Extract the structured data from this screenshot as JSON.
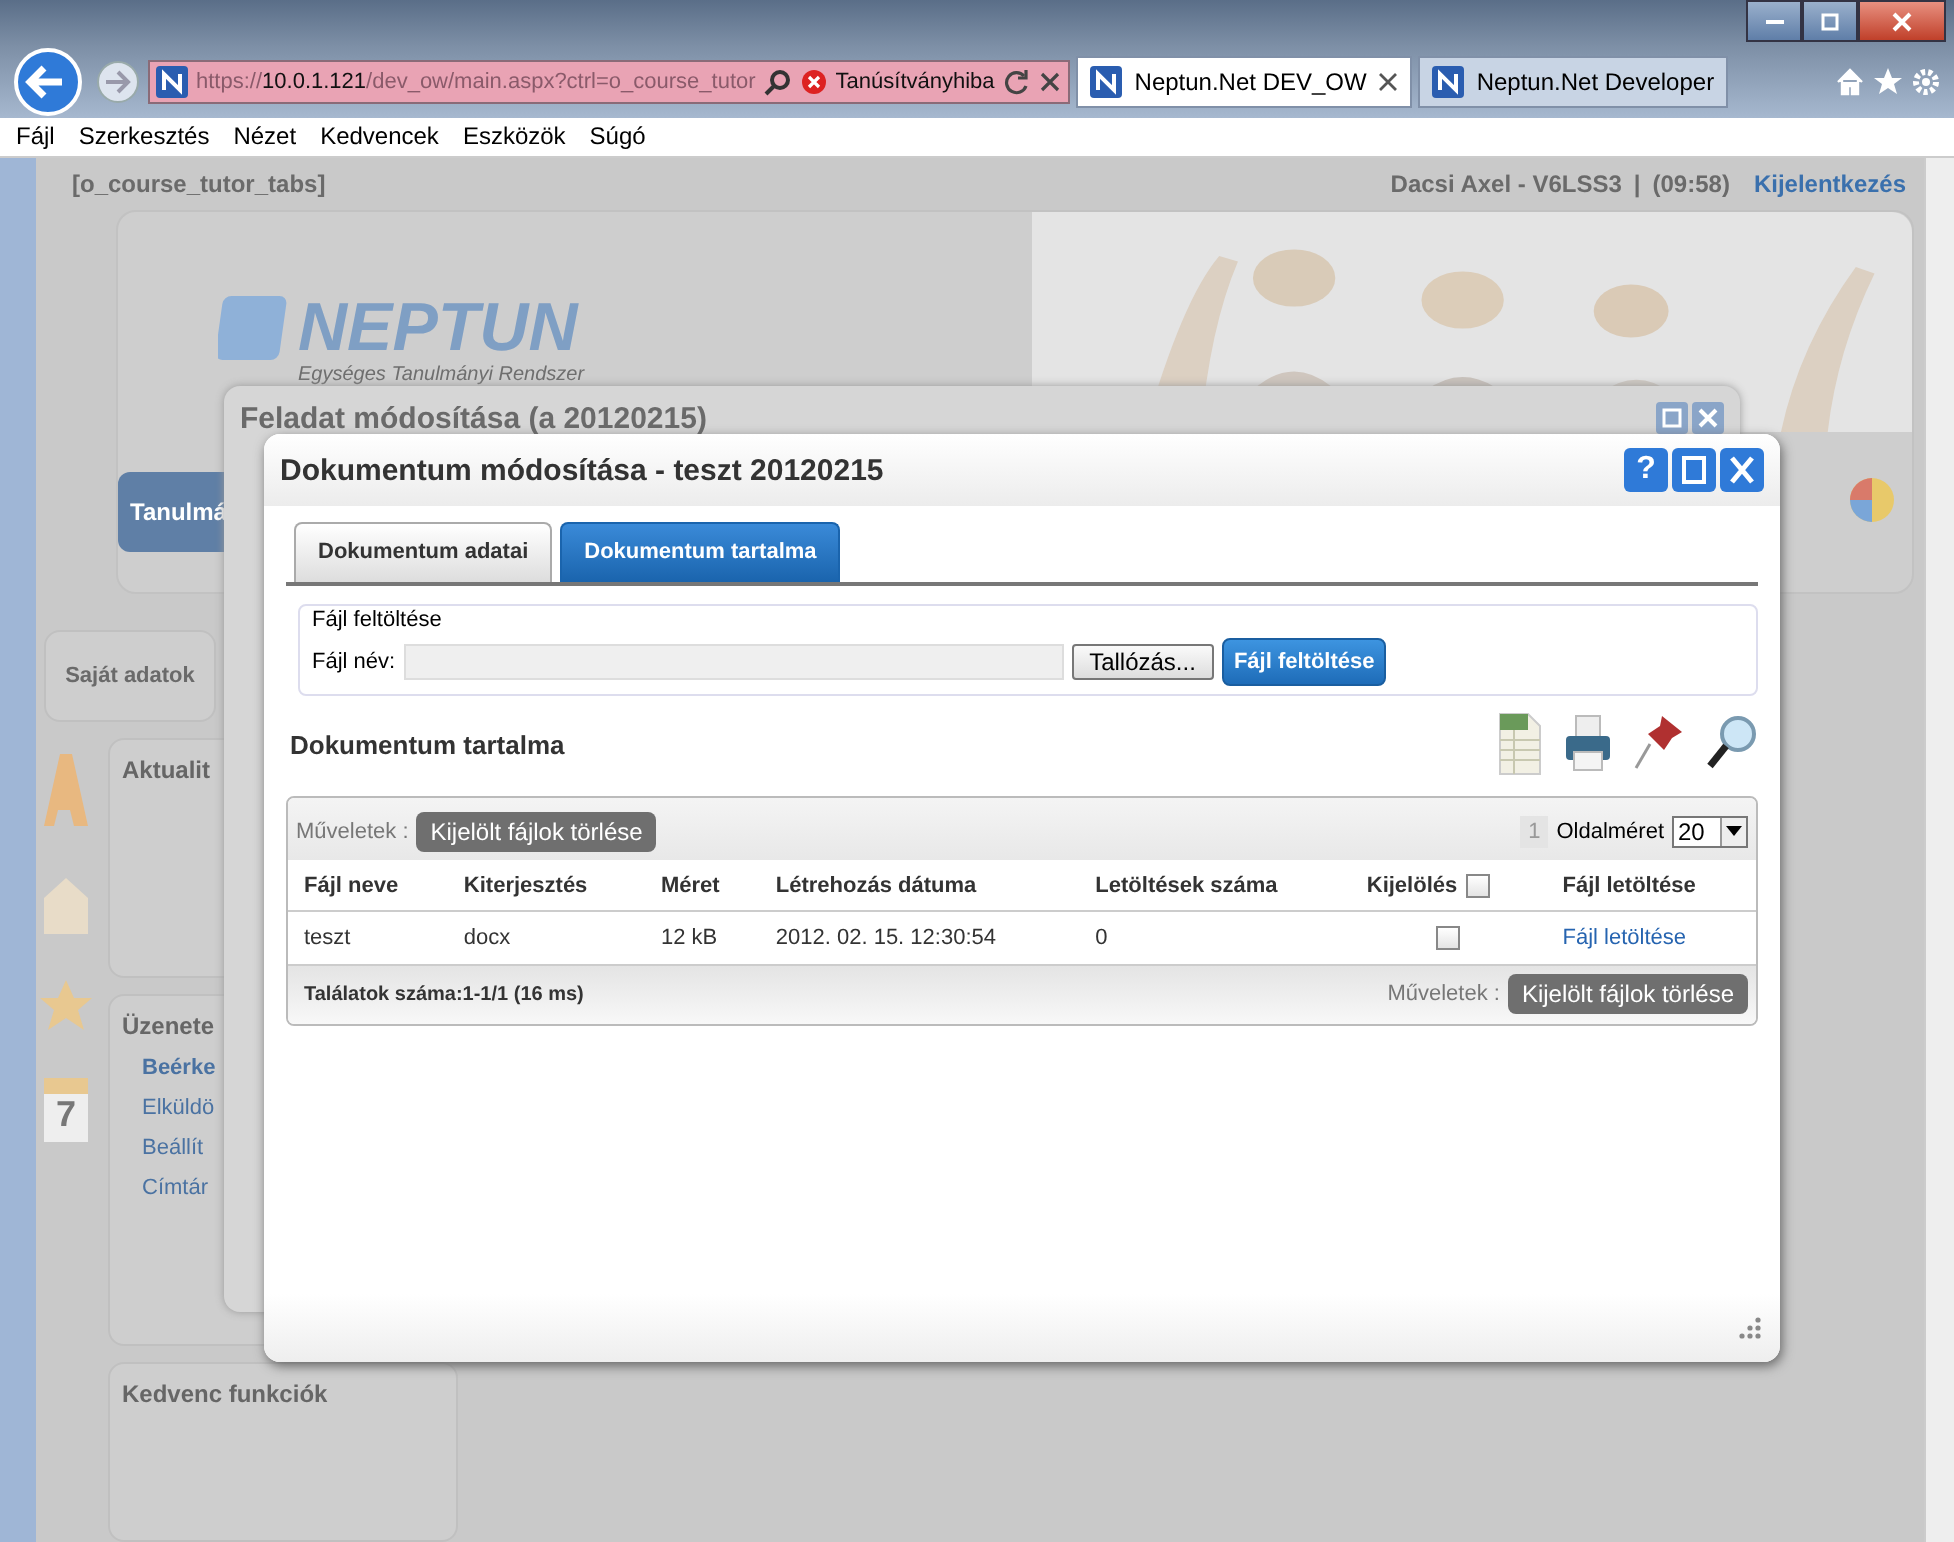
{
  "browser": {
    "address": {
      "prefix": "https://",
      "host": "10.0.1.121",
      "path": "/dev_ow/main.aspx?ctrl=o_course_tutor"
    },
    "cert_error": "Tanúsítványhiba",
    "tabs": [
      {
        "label": "Neptun.Net DEV_OW",
        "selected": true
      },
      {
        "label": "Neptun.Net Developer",
        "selected": false
      }
    ],
    "menu": [
      "Fájl",
      "Szerkesztés",
      "Nézet",
      "Kedvencek",
      "Eszközök",
      "Súgó"
    ]
  },
  "page": {
    "context": "[o_course_tutor_tabs]",
    "user": "Dacsi Axel - V6LSS3",
    "separator": "|",
    "time": "(09:58)",
    "logout": "Kijelentkezés",
    "logo": "NEPTUN",
    "logo_sub": "Egységes Tanulmányi Rendszer",
    "side_tab": "Tanulmá",
    "nav": "Saját adatok",
    "calendar_day": "7",
    "panels": [
      {
        "title": "Aktualit"
      },
      {
        "title": "Üzenete",
        "links": [
          {
            "label": "Beérke",
            "unread": true
          },
          {
            "label": "Elküldö",
            "unread": false
          },
          {
            "label": "Beállít",
            "unread": false
          },
          {
            "label": "Címtár",
            "unread": false
          }
        ]
      },
      {
        "title": "Kedvenc funkciók"
      }
    ]
  },
  "back_dialog": {
    "title": "Feladat módosítása (a 20120215)"
  },
  "dialog": {
    "title": "Dokumentum módosítása - teszt 20120215",
    "help": "?",
    "tabs": [
      {
        "label": "Dokumentum adatai",
        "selected": false
      },
      {
        "label": "Dokumentum tartalma",
        "selected": true
      }
    ],
    "upload": {
      "legend": "Fájl feltöltése",
      "label": "Fájl név:",
      "browse": "Tallózás...",
      "submit": "Fájl feltöltése"
    },
    "section_title": "Dokumentum tartalma",
    "grid": {
      "actions_label": "Műveletek :",
      "delete": "Kijelölt fájlok törlése",
      "page": "1",
      "page_size_label": "Oldalméret",
      "page_size": "20",
      "columns": [
        "Fájl neve",
        "Kiterjesztés",
        "Méret",
        "Létrehozás dátuma",
        "Letöltések száma",
        "Kijelölés",
        "Fájl letöltése"
      ],
      "select_all": {
        "checked": false
      },
      "rows": [
        {
          "cells": [
            "teszt",
            "docx",
            "12 kB",
            "2012. 02. 15. 12:30:54",
            "0"
          ],
          "selected": false,
          "link": "Fájl letöltése"
        }
      ],
      "footer": "Találatok száma:1-1/1 (16 ms)",
      "footer_actions_label": "Műveletek :",
      "footer_delete": "Kijelölt fájlok törlése"
    }
  }
}
